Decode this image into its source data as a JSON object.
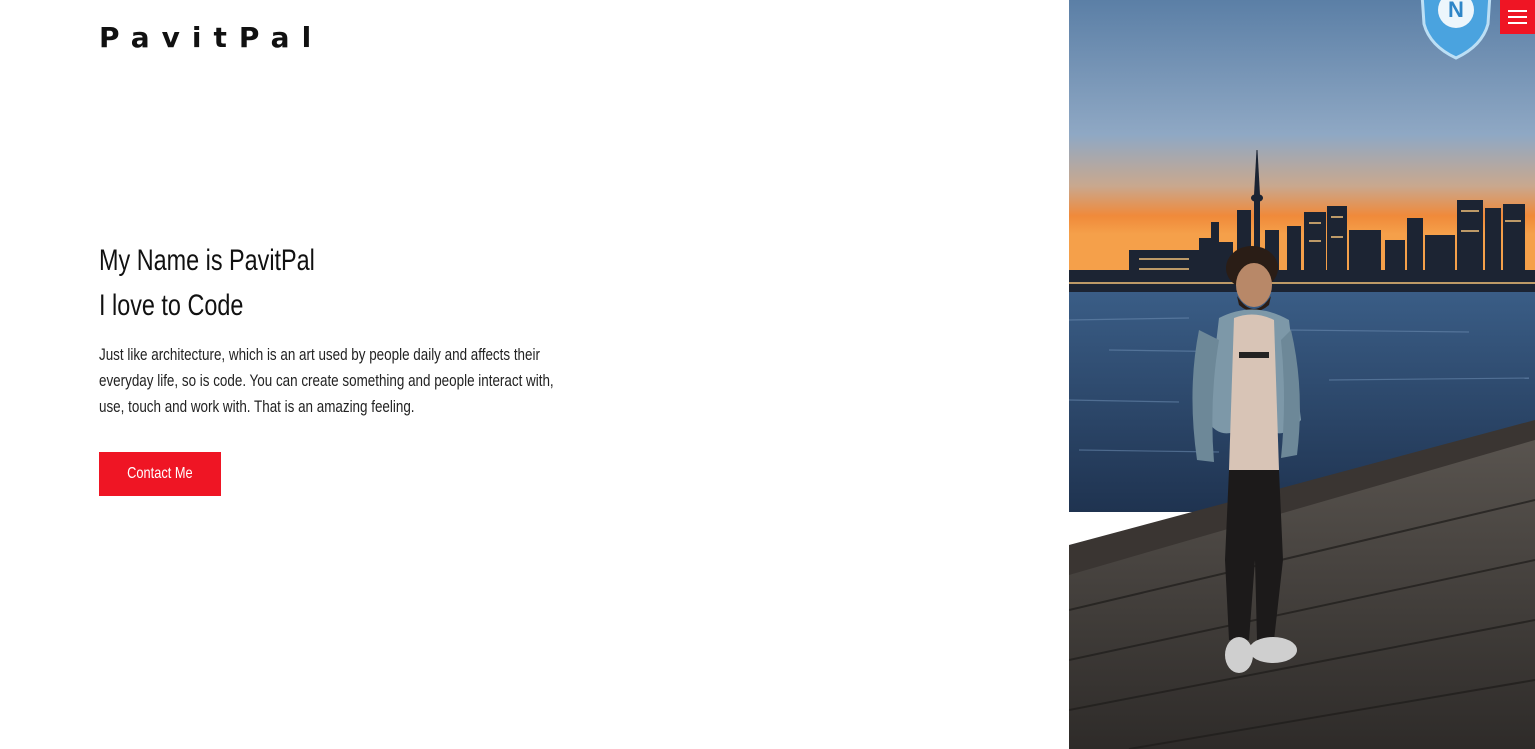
{
  "site": {
    "logo_text": "PavitPal"
  },
  "hero": {
    "heading_line1": "My Name is PavitPal",
    "heading_line2": "I love to Code",
    "description": "Just like architecture, which is an art used by people daily and affects their everyday life, so is code. You can create something and people interact with, use, touch and work with. That is an amazing feeling.",
    "cta_label": "Contact Me"
  },
  "badge": {
    "letter": "N"
  },
  "colors": {
    "accent": "#ef1524",
    "text": "#111111",
    "background": "#ffffff"
  },
  "icons": {
    "menu": "hamburger-icon",
    "badge": "shield-badge-icon"
  }
}
